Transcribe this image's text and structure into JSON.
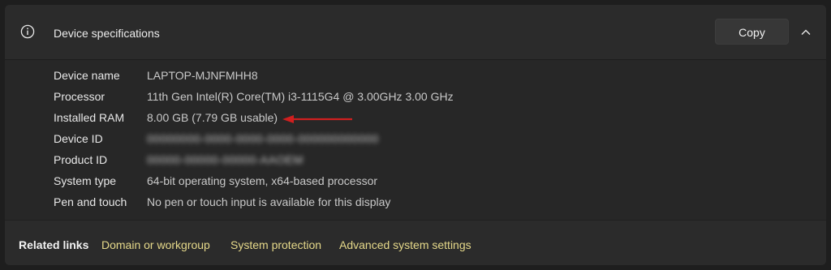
{
  "header": {
    "title": "Device specifications",
    "copy_label": "Copy",
    "icon": "info-icon",
    "collapse_icon": "chevron-up-icon"
  },
  "specs": [
    {
      "label": "Device name",
      "value": "LAPTOP-MJNFMHH8"
    },
    {
      "label": "Processor",
      "value": "11th Gen Intel(R) Core(TM) i3-1115G4 @ 3.00GHz   3.00 GHz"
    },
    {
      "label": "Installed RAM",
      "value": "8.00 GB (7.79 GB usable)"
    },
    {
      "label": "Device ID",
      "value": "",
      "blurred": true
    },
    {
      "label": "Product ID",
      "value": "",
      "blurred": true
    },
    {
      "label": "System type",
      "value": "64-bit operating system, x64-based processor"
    },
    {
      "label": "Pen and touch",
      "value": "No pen or touch input is available for this display"
    }
  ],
  "annotation": {
    "color": "#d01f1f"
  },
  "footer": {
    "related_label": "Related links",
    "links": [
      "Domain or workgroup",
      "System protection",
      "Advanced system settings"
    ]
  },
  "colors": {
    "link": "#e6d98a",
    "background": "#272727"
  }
}
